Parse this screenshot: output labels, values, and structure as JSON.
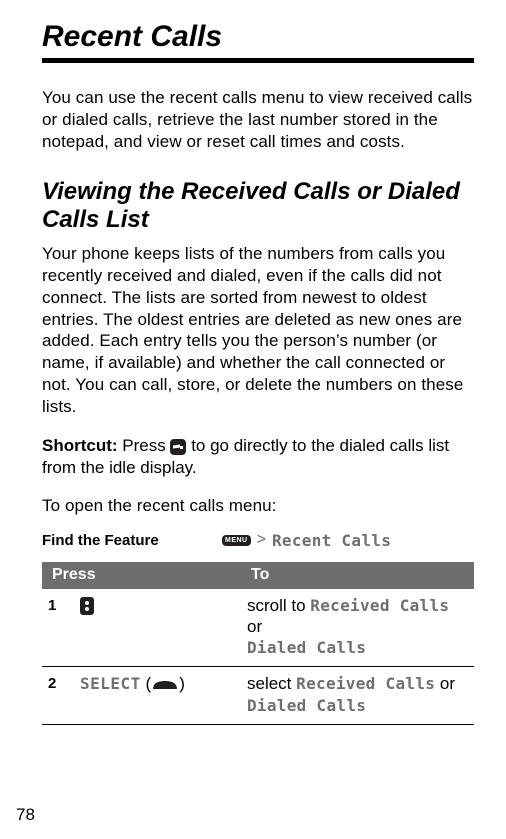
{
  "chapter_title": "Recent Calls",
  "intro": "You can use the recent calls menu to view received calls or dialed calls, retrieve the last number stored in the notepad, and view or reset call times and costs.",
  "section_title": "Viewing the Received Calls or Dialed Calls List",
  "section_body": "Your phone keeps lists of the numbers from calls you recently received and dialed, even if the calls did not connect. The lists are sorted from newest to oldest entries. The oldest entries are deleted as new ones are added. Each entry tells you the person’s number (or name, if available) and whether the call connected or not. You can call, store, or delete the numbers on these lists.",
  "shortcut": {
    "label": "Shortcut:",
    "before": "Press ",
    "after": " to go directly to the dialed calls list from the idle display."
  },
  "open_prompt": "To open the recent calls menu:",
  "feature": {
    "label": "Find the Feature",
    "menu_key": "MENU",
    "gt": ">",
    "menu_item": "Recent Calls"
  },
  "table": {
    "head": {
      "press": "Press",
      "to": "To"
    },
    "rows": [
      {
        "num": "1",
        "press_type": "scroll-key",
        "press_label": "",
        "to_before": "scroll to ",
        "to_mono1": "Received Calls",
        "to_mid": " or ",
        "to_mono2": "Dialed Calls"
      },
      {
        "num": "2",
        "press_type": "softkey",
        "press_label": "SELECT",
        "to_before": "select ",
        "to_mono1": "Received Calls",
        "to_mid": " or ",
        "to_mono2": "Dialed Calls"
      }
    ]
  },
  "page_number": "78"
}
